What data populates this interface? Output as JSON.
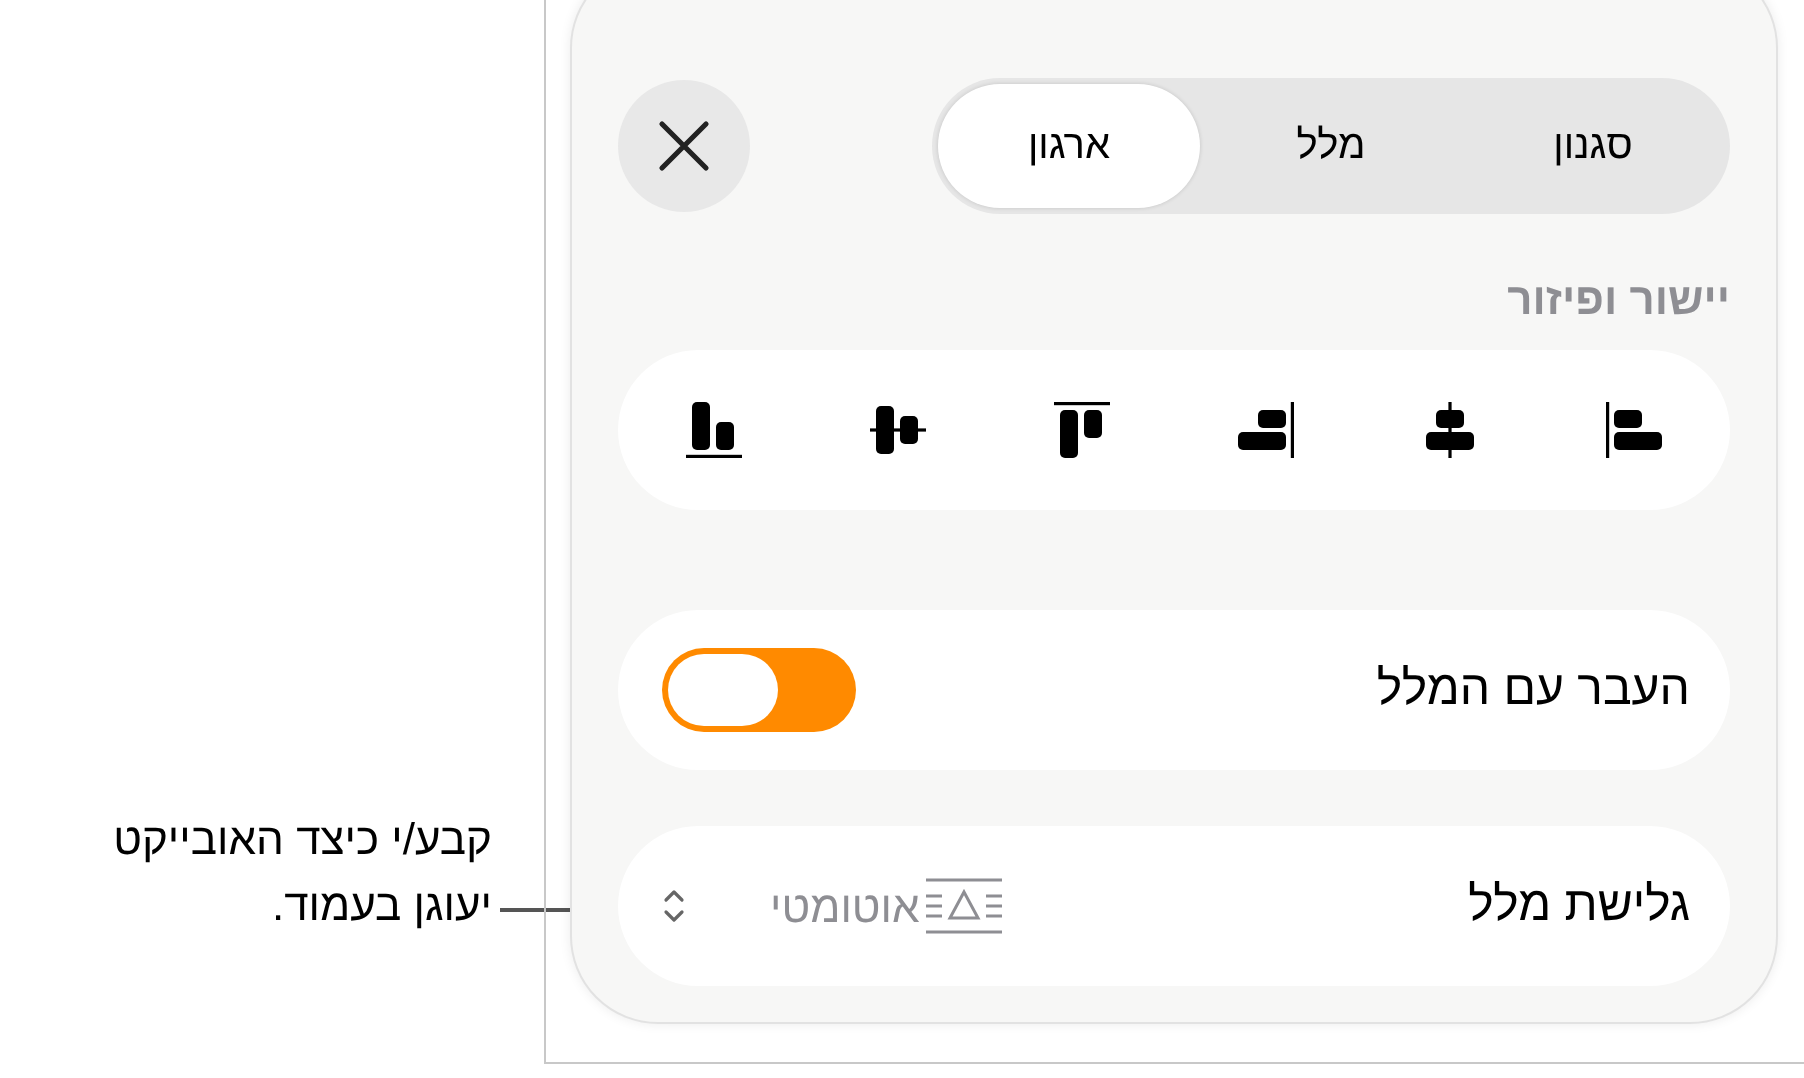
{
  "tabs": [
    {
      "label": "סגנון",
      "selected": false
    },
    {
      "label": "מלל",
      "selected": false
    },
    {
      "label": "ארגון",
      "selected": true
    }
  ],
  "section_title": "יישור ופיזור",
  "move_with_text": {
    "label": "העבר עם המלל",
    "on": true
  },
  "text_wrap": {
    "label": "גלישת מלל",
    "value": "אוטומטי"
  },
  "callout": "קבע/י כיצד האובייקט יעוגן בעמוד."
}
